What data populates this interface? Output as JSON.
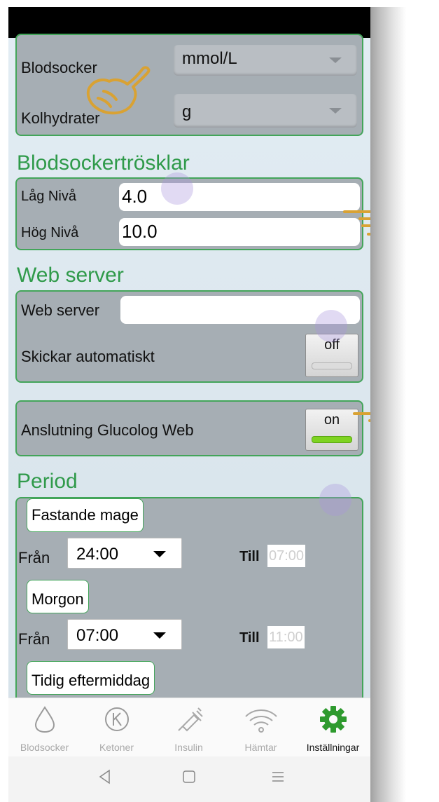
{
  "units": {
    "blood_sugar_label": "Blodsocker",
    "blood_sugar_unit": "mmol/L",
    "carbs_label": "Kolhydrater",
    "carbs_unit": "g"
  },
  "thresholds": {
    "title": "Blodsockertrösklar",
    "low_label": "Låg Nivå",
    "low_value": "4.0",
    "high_label": "Hög Nivå",
    "high_value": "10.0"
  },
  "web_server": {
    "title": "Web server",
    "server_label": "Web server",
    "server_value": "",
    "auto_send_label": "Skickar automatiskt",
    "auto_send_toggle": "off"
  },
  "glucolog": {
    "label": "Anslutning Glucolog Web",
    "toggle": "on"
  },
  "period": {
    "title": "Period",
    "from_label": "Från",
    "to_label": "Till",
    "items": [
      {
        "name": "Fastande mage",
        "from": "24:00",
        "to": "07:00"
      },
      {
        "name": "Morgon",
        "from": "07:00",
        "to": "11:00"
      },
      {
        "name": "Tidig eftermiddag"
      }
    ]
  },
  "bottom_nav": [
    {
      "label": "Blodsocker",
      "icon": "drop-icon"
    },
    {
      "label": "Ketoner",
      "icon": "ketone-icon"
    },
    {
      "label": "Insulin",
      "icon": "syringe-icon"
    },
    {
      "label": "Hämtar",
      "icon": "wifi-icon"
    },
    {
      "label": "Inställningar",
      "icon": "gear-icon",
      "active": true
    }
  ],
  "colors": {
    "accent": "#2f9a4a",
    "toggle_on": "#7ed321",
    "panel_bg": "#a6aeb4"
  }
}
